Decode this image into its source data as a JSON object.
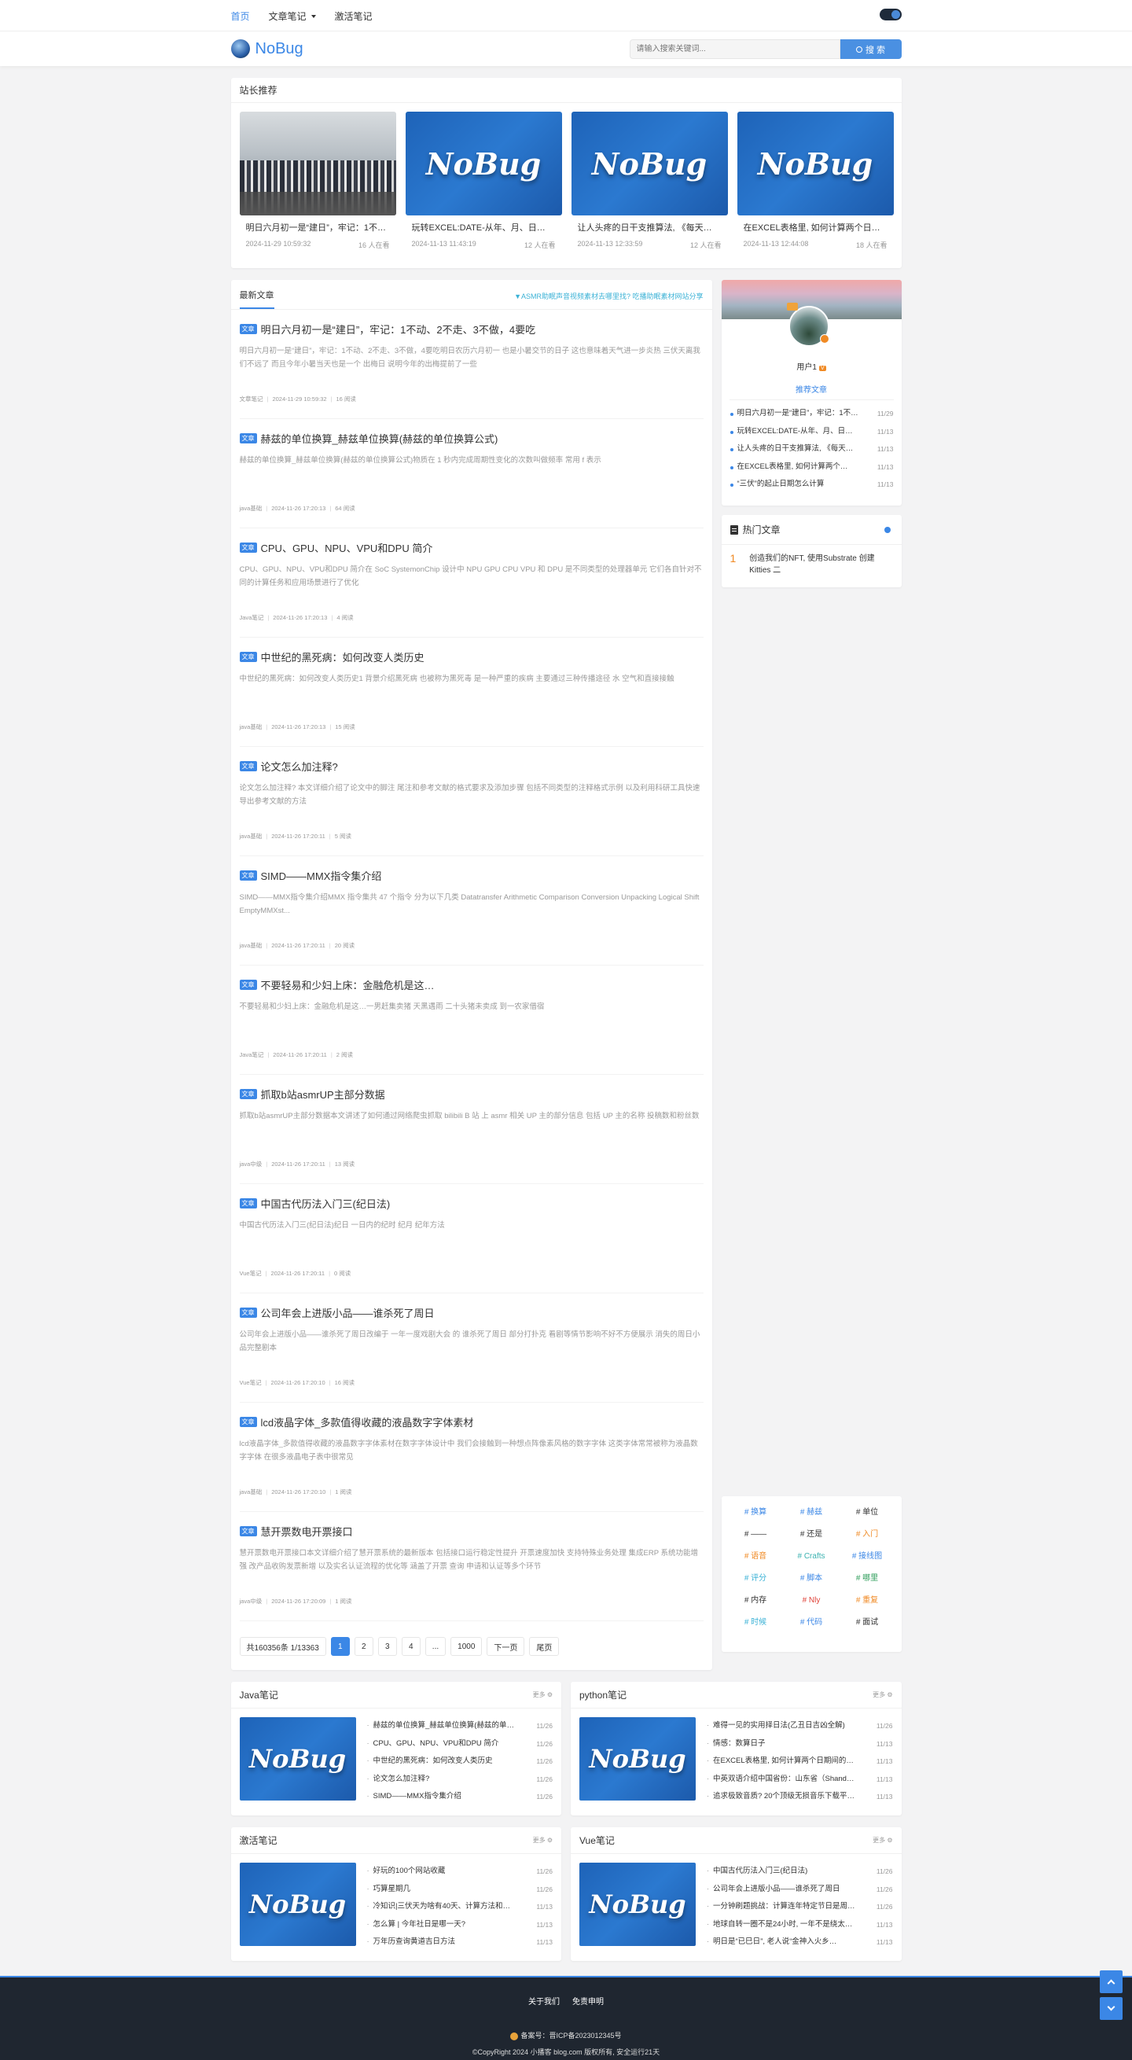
{
  "topnav": {
    "items": [
      {
        "label": "首页",
        "active": true
      },
      {
        "label": "文章笔记",
        "dropdown": true
      },
      {
        "label": "激活笔记"
      }
    ]
  },
  "header": {
    "logo_text": "NoBug",
    "search_placeholder": "请输入搜索关键词...",
    "search_button": "搜 索"
  },
  "recommend": {
    "title": "站长推荐",
    "items": [
      {
        "title": "明日六月初一是“建日”，牢记：1不动、2不走、3不做，4要吃",
        "date": "2024-11-29 10:59:32",
        "views": "16 人在看",
        "image": "photo"
      },
      {
        "title": "玩转EXCEL:DATE-从年、月、日…",
        "date": "2024-11-13 11:43:19",
        "views": "12 人在看",
        "image": "nobug"
      },
      {
        "title": "让人头疼的日干支推算法, 《每天…",
        "date": "2024-11-13 12:33:59",
        "views": "12 人在看",
        "image": "nobug"
      },
      {
        "title": "在EXCEL表格里, 如何计算两个日…",
        "date": "2024-11-13 12:44:08",
        "views": "18 人在看",
        "image": "nobug"
      }
    ]
  },
  "latest": {
    "tab": "最新文章",
    "ad": "▼ASMR助眠声音视频素材去哪里找? 吃播助眠素材网站分享",
    "tag_label": "文章",
    "posts": [
      {
        "title": "明日六月初一是“建日”，牢记：1不动、2不走、3不做，4要吃",
        "desc": "明日六月初一是“建日”，牢记：1不动、2不走、3不做，4要吃明日农历六月初一 也是小暑交节的日子 这也意味着天气进一步炎热 三伏天离我们不远了 而且今年小暑当天也是一个 出梅日 说明今年的出梅提前了一些",
        "category": "文章笔记",
        "date": "2024-11-29 10:59:32",
        "reads": "16 阅读"
      },
      {
        "title": "赫兹的单位换算_赫兹单位换算(赫兹的单位换算公式)",
        "desc": "赫兹的单位换算_赫兹单位换算(赫兹的单位换算公式)物质在 1 秒内完成周期性变化的次数叫做频率 常用 f 表示",
        "category": "java基础",
        "date": "2024-11-26 17:20:13",
        "reads": "64 阅读"
      },
      {
        "title": "CPU、GPU、NPU、VPU和DPU 简介",
        "desc": "CPU、GPU、NPU、VPU和DPU 简介在 SoC SystemonChip 设计中 NPU GPU CPU VPU 和 DPU 是不同类型的处理器单元 它们各自针对不同的计算任务和应用场景进行了优化",
        "category": "Java笔记",
        "date": "2024-11-26 17:20:13",
        "reads": "4 阅读"
      },
      {
        "title": "中世纪的黑死病：如何改变人类历史",
        "desc": "中世纪的黑死病：如何改变人类历史1 背景介绍黑死病 也被称为黑死毒 是一种严重的疾病 主要通过三种传播途径 水 空气和直接接触",
        "category": "java基础",
        "date": "2024-11-26 17:20:13",
        "reads": "15 阅读"
      },
      {
        "title": "论文怎么加注释?",
        "desc": "论文怎么加注释? 本文详细介绍了论文中的脚注 尾注和参考文献的格式要求及添加步骤 包括不同类型的注释格式示例 以及利用科研工具快速导出参考文献的方法",
        "category": "java基础",
        "date": "2024-11-26 17:20:11",
        "reads": "5 阅读"
      },
      {
        "title": "SIMD——MMX指令集介绍",
        "desc": "SIMD——MMX指令集介绍MMX 指令集共 47 个指令 分为以下几类 Datatransfer Arithmetic Comparison Conversion Unpacking Logical Shift EmptyMMXst...",
        "category": "java基础",
        "date": "2024-11-26 17:20:11",
        "reads": "20 阅读"
      },
      {
        "title": "不要轻易和少妇上床：金融危机是这…",
        "desc": "不要轻易和少妇上床：金融危机是这…一男赶集卖猪 天黑遇雨 二十头猪未卖成 到一农家借宿",
        "category": "Java笔记",
        "date": "2024-11-26 17:20:11",
        "reads": "2 阅读"
      },
      {
        "title": "抓取b站asmrUP主部分数据",
        "desc": "抓取b站asmrUP主部分数据本文讲述了如何通过网络爬虫抓取 bilibili B 站 上 asmr 相关 UP 主的部分信息 包括 UP 主的名称 投稿数和粉丝数",
        "category": "java中级",
        "date": "2024-11-26 17:20:11",
        "reads": "13 阅读"
      },
      {
        "title": "中国古代历法入门三(纪日法)",
        "desc": "中国古代历法入门三(纪日法)纪日 一日内的纪时 纪月 纪年方法",
        "category": "Vue笔记",
        "date": "2024-11-26 17:20:11",
        "reads": "0 阅读"
      },
      {
        "title": "公司年会上进版小品——谁杀死了周日",
        "desc": "公司年会上进版小品——谁杀死了周日改编于 一年一度戏剧大会 的 谁杀死了周日 部分打扑克 看剧等情节影响不好不方便展示 消失的周日小品完整剧本",
        "category": "Vue笔记",
        "date": "2024-11-26 17:20:10",
        "reads": "16 阅读"
      },
      {
        "title": "lcd液晶字体_多款值得收藏的液晶数字字体素材",
        "desc": "lcd液晶字体_多款值得收藏的液晶数字字体素材在数字字体设计中 我们会接触到一种想点阵像素风格的数字字体 这类字体常常被称为液晶数字字体 在很多液晶电子表中很常见",
        "category": "java基础",
        "date": "2024-11-26 17:20:10",
        "reads": "1 阅读"
      },
      {
        "title": "慧开票数电开票接口",
        "desc": "慧开票数电开票接口本文详细介绍了慧开票系统的最新版本 包括接口运行稳定性提升 开票速度加快 支持特殊业务处理 集成ERP 系统功能增强 改产品收购发票新增 以及实名认证流程的优化等 涵盖了开票 查询 申请和认证等多个环节",
        "category": "java中级",
        "date": "2024-11-26 17:20:09",
        "reads": "1 阅读"
      }
    ],
    "pager": {
      "summary": "共160356条 1/13363",
      "pages": [
        "1",
        "2",
        "3",
        "4",
        "...",
        "1000"
      ],
      "current": "1",
      "next": "下一页",
      "last": "尾页"
    }
  },
  "profile": {
    "username": "用户1",
    "vip": "V",
    "rec_label": "推荐文章",
    "items": [
      {
        "title": "明日六月初一是“建日”，牢记：1不动…",
        "date": "11/29"
      },
      {
        "title": "玩转EXCEL:DATE-从年、月、日…",
        "date": "11/13"
      },
      {
        "title": "让人头疼的日干支推算法, 《每天…",
        "date": "11/13"
      },
      {
        "title": "在EXCEL表格里, 如何计算两个…",
        "date": "11/13"
      },
      {
        "title": "“三伏”的起止日期怎么计算",
        "date": "11/13"
      }
    ]
  },
  "hot": {
    "title": "热门文章",
    "items": [
      {
        "rank": "1",
        "title": "创造我们的NFT, 使用Substrate 创建Kitties 二"
      }
    ]
  },
  "tags": {
    "items": [
      {
        "label": "# 换算",
        "color": "#3b87e6"
      },
      {
        "label": "# 赫兹",
        "color": "#3b87e6"
      },
      {
        "label": "# 单位",
        "color": "#333333"
      },
      {
        "label": "# ——",
        "color": "#333333"
      },
      {
        "label": "# 还是",
        "color": "#333333"
      },
      {
        "label": "# 入门",
        "color": "#f08a24"
      },
      {
        "label": "# 语音",
        "color": "#f08a24"
      },
      {
        "label": "# Crafts",
        "color": "#3bb2b0"
      },
      {
        "label": "# 接线图",
        "color": "#3b87e6"
      },
      {
        "label": "# 评分",
        "color": "#3bb2d6"
      },
      {
        "label": "# 脚本",
        "color": "#3b87e6"
      },
      {
        "label": "# 哪里",
        "color": "#2e9d5a"
      },
      {
        "label": "# 内存",
        "color": "#333333"
      },
      {
        "label": "# Nly",
        "color": "#e0443a"
      },
      {
        "label": "# 重复",
        "color": "#f08a24"
      },
      {
        "label": "# 时候",
        "color": "#3bb2d6"
      },
      {
        "label": "# 代码",
        "color": "#3b87e6"
      },
      {
        "label": "# 面试",
        "color": "#333333"
      }
    ]
  },
  "categories": {
    "more": "更多 ⚙",
    "blocks": [
      {
        "title": "Java笔记",
        "items": [
          {
            "title": "赫兹的单位换算_赫兹单位换算(赫兹的单…",
            "date": "11/26"
          },
          {
            "title": "CPU、GPU、NPU、VPU和DPU 简介",
            "date": "11/26"
          },
          {
            "title": "中世纪的黑死病：如何改变人类历史",
            "date": "11/26"
          },
          {
            "title": "论文怎么加注释?",
            "date": "11/26"
          },
          {
            "title": "SIMD——MMX指令集介绍",
            "date": "11/26"
          }
        ]
      },
      {
        "title": "python笔记",
        "items": [
          {
            "title": "难得一见的实用择日法(乙丑日吉凶全解)",
            "date": "11/26"
          },
          {
            "title": "情感：数算日子",
            "date": "11/13"
          },
          {
            "title": "在EXCEL表格里, 如何计算两个日期间的…",
            "date": "11/13"
          },
          {
            "title": "中英双语介绍中国省份：山东省（Shand…",
            "date": "11/13"
          },
          {
            "title": "追求极致音质? 20个顶级无损音乐下载平…",
            "date": "11/13"
          }
        ]
      },
      {
        "title": "激活笔记",
        "items": [
          {
            "title": "好玩的100个网站收藏",
            "date": "11/26"
          },
          {
            "title": "巧算星期几",
            "date": "11/26"
          },
          {
            "title": "冷知识|三伏天为啥有40天、计算方法和…",
            "date": "11/13"
          },
          {
            "title": "怎么算 | 今年社日是哪一天?",
            "date": "11/13"
          },
          {
            "title": "万年历查询黄道吉日方法",
            "date": "11/13"
          }
        ]
      },
      {
        "title": "Vue笔记",
        "items": [
          {
            "title": "中国古代历法入门三(纪日法)",
            "date": "11/26"
          },
          {
            "title": "公司年会上进版小品——谁杀死了周日",
            "date": "11/26"
          },
          {
            "title": "一分钟刷题挑战：计算连年特定节日是周…",
            "date": "11/26"
          },
          {
            "title": "地球自转一圈不是24小时, 一年不是绕太…",
            "date": "11/13"
          },
          {
            "title": "明日是“已巳日”, 老人说“金神入火乡…",
            "date": "11/13"
          }
        ]
      }
    ]
  },
  "footer": {
    "links": [
      "关于我们",
      "免责申明"
    ],
    "beian": "备案号：晋ICP备2023012345号",
    "copyright": "©CopyRight 2024 小播客 blog.com 版权所有, 安全运行21天"
  },
  "colors": {
    "accent": "#3b87e6",
    "footer_bg": "#1f2630",
    "page_bg": "#f3f3f4"
  }
}
